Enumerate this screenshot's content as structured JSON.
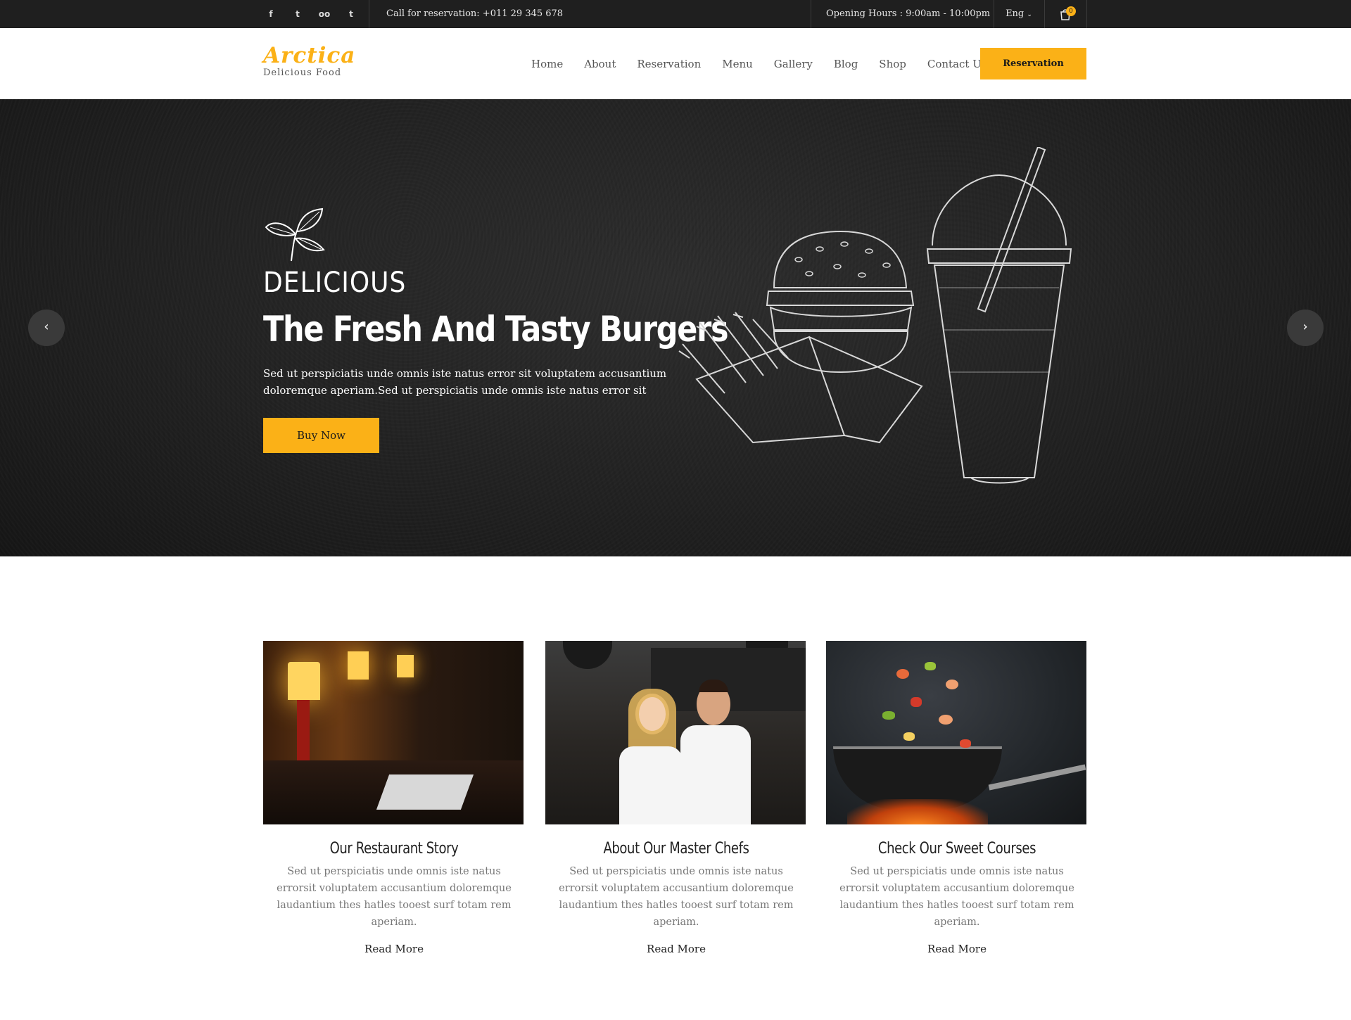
{
  "topbar": {
    "social": [
      {
        "icon": "facebook-icon",
        "glyph": "f"
      },
      {
        "icon": "twitter-icon",
        "glyph": "t"
      },
      {
        "icon": "tripadvisor-icon",
        "glyph": "oo"
      },
      {
        "icon": "tumblr-icon",
        "glyph": "t"
      }
    ],
    "call": "Call for reservation: +011 29 345 678",
    "hours": "Opening Hours : 9:00am - 10:00pm",
    "language": "Eng",
    "cart_count": "0"
  },
  "header": {
    "brand": "Arctica",
    "tagline": "Delicious Food",
    "nav": [
      "Home",
      "About",
      "Reservation",
      "Menu",
      "Gallery",
      "Blog",
      "Shop",
      "Contact Us"
    ],
    "cta": "Reservation"
  },
  "hero": {
    "kicker": "DELICIOUS",
    "title": "The Fresh And Tasty Burgers",
    "text": "Sed ut perspiciatis unde omnis iste natus error sit voluptatem accusantium doloremque aperiam.Sed ut perspiciatis unde omnis iste natus error sit",
    "button": "Buy Now",
    "prev": "‹",
    "next": "›"
  },
  "features": [
    {
      "title": "Our Restaurant Story",
      "text": "Sed ut perspiciatis unde omnis iste natus errorsit voluptatem accusantium doloremque laudantium thes hatles tooest surf totam rem aperiam.",
      "link": "Read More"
    },
    {
      "title": "About Our Master Chefs",
      "text": "Sed ut perspiciatis unde omnis iste natus errorsit voluptatem accusantium doloremque laudantium thes hatles tooest surf totam rem aperiam.",
      "link": "Read More"
    },
    {
      "title": "Check Our Sweet Courses",
      "text": "Sed ut perspiciatis unde omnis iste natus errorsit voluptatem accusantium doloremque laudantium thes hatles tooest surf totam rem aperiam.",
      "link": "Read More"
    }
  ],
  "colors": {
    "accent": "#fbb117",
    "topbar": "#1f1f1f",
    "hero_bg": "#222222"
  }
}
